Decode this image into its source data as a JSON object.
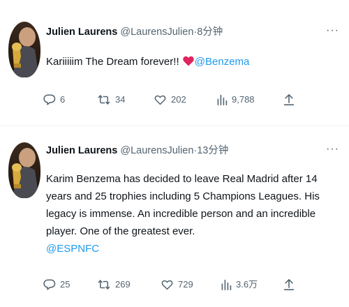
{
  "tweets": [
    {
      "author_name": "Julien Laurens",
      "author_handle": "@LaurensJulien",
      "separator": "·",
      "time": "8分钟",
      "more_label": "···",
      "text_before": "Kariiiiim The Dream forever!! ",
      "emoji": "heart-red-icon",
      "mention": "@Benzema",
      "text_after": "",
      "replies": "6",
      "retweets": "34",
      "likes": "202",
      "views": "9,788"
    },
    {
      "author_name": "Julien Laurens",
      "author_handle": "@LaurensJulien",
      "separator": "·",
      "time": "13分钟",
      "more_label": "···",
      "text": "Karim Benzema has decided to leave Real Madrid after 14 years and 25 trophies including 5 Champions Leagues. His legacy is immense. An incredible person and an incredible player. One of the greatest ever.",
      "mention": "@ESPNFC",
      "replies": "25",
      "retweets": "269",
      "likes": "729",
      "views": "3.6万"
    }
  ],
  "colors": {
    "text": "#0f1419",
    "muted": "#536471",
    "link": "#1d9bf0",
    "heart": "#e0245e",
    "divider": "#eff3f4"
  }
}
